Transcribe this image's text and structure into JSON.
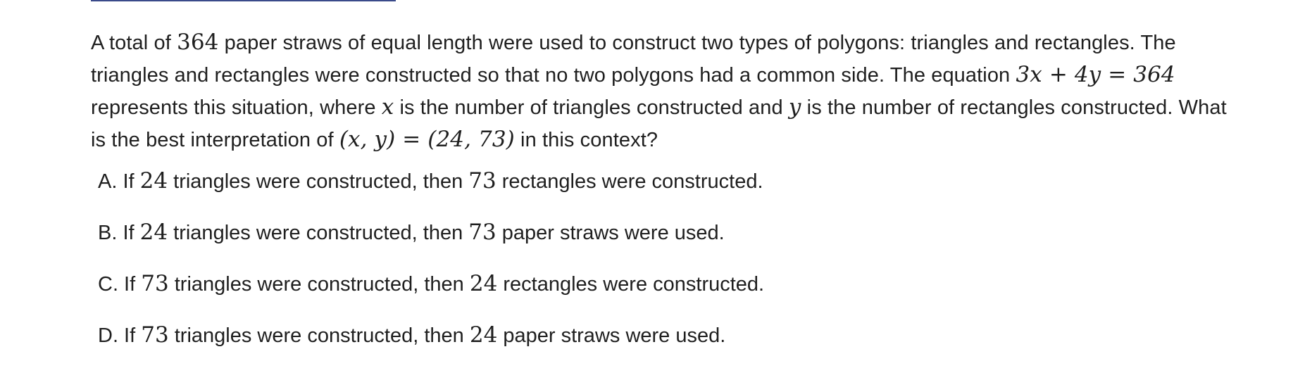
{
  "question": {
    "p1": "A total of ",
    "n364a": "364",
    "p2": " paper straws of equal length were used to construct two types of polygons: triangles and rectangles. The triangles and rectangles were constructed so that no two polygons had a common side. The equation ",
    "eq": "3x + 4y = 364",
    "p3": " represents this situation, where ",
    "x": "x",
    "p4": " is the number of triangles constructed and ",
    "y": "y",
    "p5": " is the number of rectangles constructed. What is the best interpretation of ",
    "pair": "(x, y) = (24, 73)",
    "p6": " in this context?"
  },
  "choices": [
    {
      "letter": "A.",
      "pre": " If ",
      "n1": "24",
      "mid": " triangles were constructed, then ",
      "n2": "73",
      "post": " rectangles were constructed."
    },
    {
      "letter": "B.",
      "pre": " If ",
      "n1": "24",
      "mid": " triangles were constructed, then ",
      "n2": "73",
      "post": " paper straws were used."
    },
    {
      "letter": "C.",
      "pre": " If ",
      "n1": "73",
      "mid": " triangles were constructed, then ",
      "n2": "24",
      "post": " rectangles were constructed."
    },
    {
      "letter": "D.",
      "pre": " If ",
      "n1": "73",
      "mid": " triangles were constructed, then ",
      "n2": "24",
      "post": " paper straws were used."
    }
  ]
}
